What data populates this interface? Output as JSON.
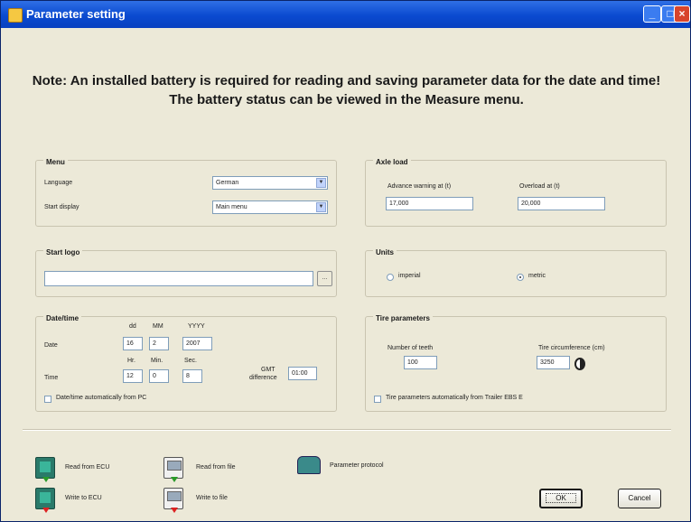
{
  "window": {
    "title": "Parameter setting",
    "minimize": "_",
    "maximize": "□",
    "close": "×"
  },
  "note": "Note: An installed battery is required for reading and saving parameter data for the date and time! The battery status can be viewed in the Measure menu.",
  "menu": {
    "title": "Menu",
    "language_label": "Language",
    "language_value": "German",
    "start_display_label": "Start display",
    "start_display_value": "Main menu",
    "arrow": "▼"
  },
  "axle_load": {
    "title": "Axle load",
    "advance_warning_label": "Advance warning at (t)",
    "advance_warning_value": "17,000",
    "overload_label": "Overload at (t)",
    "overload_value": "20,000"
  },
  "start_logo": {
    "title": "Start logo",
    "value": "",
    "browse_label": "..."
  },
  "units": {
    "title": "Units",
    "imperial_label": "imperial",
    "metric_label": "metric",
    "selected": "metric"
  },
  "datetime": {
    "title": "Date/time",
    "dd": "dd",
    "mm": "MM",
    "yyyy": "YYYY",
    "date_label": "Date",
    "day": "16",
    "month": "2",
    "year": "2007",
    "hr": "Hr.",
    "min": "Min.",
    "sec": "Sec.",
    "time_label": "Time",
    "hour_value": "12",
    "minute_value": "0",
    "second_value": "8",
    "gmt_label_1": "GMT",
    "gmt_label_2": "difference",
    "gmt_value": "01:00",
    "auto_label": "Date/time automatically from PC"
  },
  "tire": {
    "title": "Tire parameters",
    "teeth_label": "Number of teeth",
    "teeth_value": "100",
    "circ_label": "Tire circumference (cm)",
    "circ_value": "3250",
    "auto_label": "Tire parameters automatically from Trailer EBS E"
  },
  "actions": {
    "read_ecu": "Read from ECU",
    "write_ecu": "Write to ECU",
    "read_file": "Read from file",
    "write_file": "Write to file",
    "protocol": "Parameter protocol",
    "ok": "OK",
    "cancel": "Cancel"
  }
}
